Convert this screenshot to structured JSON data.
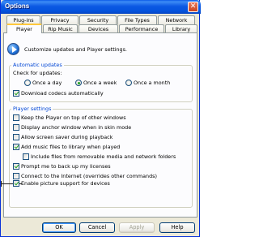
{
  "window": {
    "title": "Options",
    "close_glyph": "✕"
  },
  "tabs_back": [
    "Plug-ins",
    "Privacy",
    "Security",
    "File Types",
    "Network"
  ],
  "tabs_front": [
    "Player",
    "Rip Music",
    "Devices",
    "Performance",
    "Library"
  ],
  "active_tab": "Player",
  "intro": "Customize updates and Player settings.",
  "updates": {
    "group_label": "Automatic updates",
    "check_label": "Check for updates:",
    "options": [
      "Once a day",
      "Once a week",
      "Once a month"
    ],
    "selected": "Once a week",
    "download_codecs": {
      "label": "Download codecs automatically",
      "checked": true
    }
  },
  "settings": {
    "group_label": "Player settings",
    "items": [
      {
        "label": "Keep the Player on top of other windows",
        "checked": false
      },
      {
        "label": "Display anchor window when in skin mode",
        "checked": false
      },
      {
        "label": "Allow screen saver during playback",
        "checked": false
      },
      {
        "label": "Add music files to library when played",
        "checked": true
      },
      {
        "label": "Include files from removable media and network folders",
        "checked": false
      },
      {
        "label": "Prompt me to back up my licenses",
        "checked": true
      },
      {
        "label": "Connect to the Internet (overrides other commands)",
        "checked": false
      },
      {
        "label": "Enable picture support for devices",
        "checked": true
      }
    ]
  },
  "buttons": {
    "ok": "OK",
    "cancel": "Cancel",
    "apply": "Apply",
    "help": "Help"
  },
  "colors": {
    "title_blue": "#0a5ae6",
    "group_title": "#0046d5",
    "check_green": "#21a121",
    "tab_highlight": "#ffc83c"
  }
}
